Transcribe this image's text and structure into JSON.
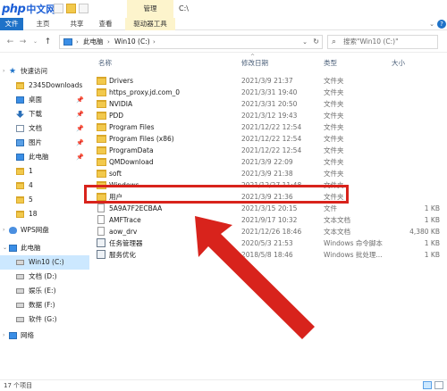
{
  "titlebar": {
    "logo_php": "php",
    "logo_cn": "中文网",
    "context_tab": "管理",
    "title": "C:\\"
  },
  "ribbon": {
    "tabs": [
      "文件",
      "主页",
      "共享",
      "查看",
      "驱动器工具"
    ]
  },
  "address": {
    "segments": [
      "此电脑",
      "Win10 (C:)"
    ],
    "search_placeholder": "搜索\"Win10 (C:)\""
  },
  "navpane": {
    "items": [
      {
        "label": "快速访问",
        "icon": "star-icon",
        "pinned": false
      },
      {
        "label": "2345Downloads",
        "icon": "folder-icon",
        "pinned": true
      },
      {
        "label": "桌面",
        "icon": "desktop-icon",
        "pinned": true
      },
      {
        "label": "下载",
        "icon": "download-icon",
        "pinned": true
      },
      {
        "label": "文档",
        "icon": "document-icon",
        "pinned": true
      },
      {
        "label": "图片",
        "icon": "picture-icon",
        "pinned": true
      },
      {
        "label": "此电脑",
        "icon": "pc-icon",
        "pinned": true
      },
      {
        "label": "1",
        "icon": "folder-icon",
        "pinned": false
      },
      {
        "label": "4",
        "icon": "folder-icon",
        "pinned": false
      },
      {
        "label": "5",
        "icon": "folder-icon",
        "pinned": false
      },
      {
        "label": "18",
        "icon": "folder-icon",
        "pinned": false
      },
      {
        "label": "WPS网盘",
        "icon": "cloud-icon",
        "pinned": false
      },
      {
        "label": "此电脑",
        "icon": "pc-icon",
        "pinned": false
      },
      {
        "label": "Win10 (C:)",
        "icon": "drive-icon",
        "pinned": false,
        "selected": true
      },
      {
        "label": "文档 (D:)",
        "icon": "drive-icon",
        "pinned": false
      },
      {
        "label": "娱乐 (E:)",
        "icon": "drive-icon",
        "pinned": false
      },
      {
        "label": "数据 (F:)",
        "icon": "drive-icon",
        "pinned": false
      },
      {
        "label": "软件 (G:)",
        "icon": "drive-icon",
        "pinned": false
      },
      {
        "label": "网络",
        "icon": "network-icon",
        "pinned": false
      }
    ]
  },
  "columns": {
    "name": "名称",
    "date": "修改日期",
    "type": "类型",
    "size": "大小"
  },
  "files": [
    {
      "name": "Drivers",
      "date": "2021/3/9 21:37",
      "type": "文件夹",
      "size": "",
      "kind": "folder"
    },
    {
      "name": "https_proxy.jd.com_0",
      "date": "2021/3/31 19:40",
      "type": "文件夹",
      "size": "",
      "kind": "folder"
    },
    {
      "name": "NVIDIA",
      "date": "2021/3/31 20:50",
      "type": "文件夹",
      "size": "",
      "kind": "folder"
    },
    {
      "name": "PDD",
      "date": "2021/3/12 19:43",
      "type": "文件夹",
      "size": "",
      "kind": "folder"
    },
    {
      "name": "Program Files",
      "date": "2021/12/22 12:54",
      "type": "文件夹",
      "size": "",
      "kind": "folder"
    },
    {
      "name": "Program Files (x86)",
      "date": "2021/12/22 12:54",
      "type": "文件夹",
      "size": "",
      "kind": "folder"
    },
    {
      "name": "ProgramData",
      "date": "2021/12/22 12:54",
      "type": "文件夹",
      "size": "",
      "kind": "folder"
    },
    {
      "name": "QMDownload",
      "date": "2021/3/9 22:09",
      "type": "文件夹",
      "size": "",
      "kind": "folder"
    },
    {
      "name": "soft",
      "date": "2021/3/9 21:38",
      "type": "文件夹",
      "size": "",
      "kind": "folder"
    },
    {
      "name": "Windows",
      "date": "2021/12/27 11:48",
      "type": "文件夹",
      "size": "",
      "kind": "folder"
    },
    {
      "name": "用户",
      "date": "2021/3/9 21:36",
      "type": "文件夹",
      "size": "",
      "kind": "folder"
    },
    {
      "name": "5A9A7F2ECBAA",
      "date": "2021/3/15 20:15",
      "type": "文件",
      "size": "1 KB",
      "kind": "file"
    },
    {
      "name": "AMFTrace",
      "date": "2021/9/17 10:32",
      "type": "文本文档",
      "size": "1 KB",
      "kind": "file"
    },
    {
      "name": "aow_drv",
      "date": "2021/12/26 18:46",
      "type": "文本文档",
      "size": "4,380 KB",
      "kind": "file"
    },
    {
      "name": "任务管理器",
      "date": "2020/5/3 21:53",
      "type": "Windows 命令脚本",
      "size": "1 KB",
      "kind": "bat"
    },
    {
      "name": "服务优化",
      "date": "2018/5/8 18:46",
      "type": "Windows 批处理...",
      "size": "1 KB",
      "kind": "bat"
    }
  ],
  "status": {
    "text": "17 个项目"
  },
  "colors": {
    "accent": "#1e72c8",
    "highlight_box": "#d8231c",
    "folder": "#f2c94c",
    "selected_nav": "#cce8ff"
  }
}
